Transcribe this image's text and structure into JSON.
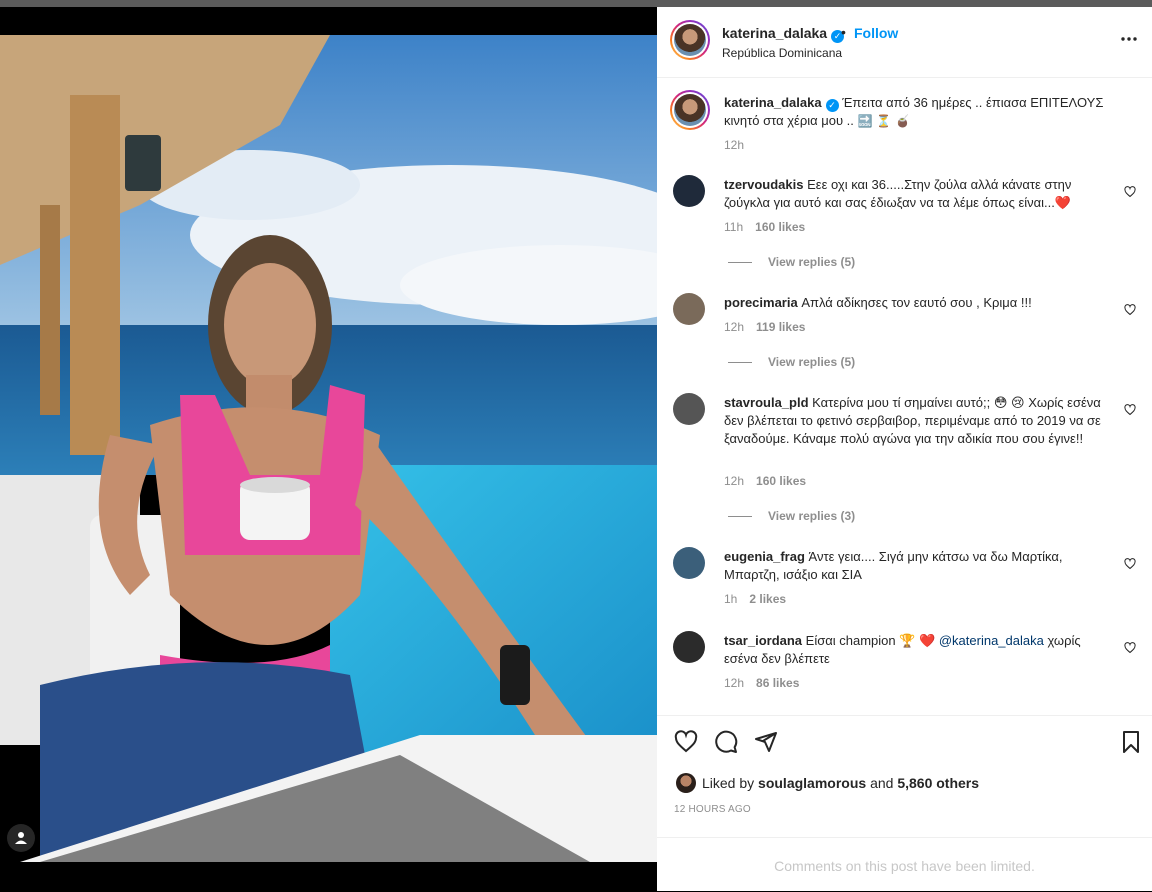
{
  "post": {
    "author": "katerina_dalaka",
    "follow_label": "Follow",
    "location": "República Dominicana",
    "more_label": "•••",
    "caption_text": "Έπειτα από 36 ημέρες .. έπιασα ΕΠΙΤΕΛΟΥΣ κινητό στα χέρια μου ..",
    "caption_emoji": "🔜 ⏳ 🧉",
    "caption_time": "12h"
  },
  "comments": [
    {
      "user": "tzervoudakis",
      "text": "Εεε οχι και 36.....Στην ζούλα αλλά κάνατε στην ζούγκλα για αυτό και σας έδιωξαν να τα λέμε όπως είναι...❤️",
      "time": "11h",
      "likes": "160 likes",
      "replies": "View replies (5)",
      "avatar_color": "#1f2a3a"
    },
    {
      "user": "porecimaria",
      "text": "Απλά αδίκησες τον εαυτό σου , Κριμα !!!",
      "time": "12h",
      "likes": "119 likes",
      "replies": "View replies (5)",
      "avatar_color": "#7a6a5a"
    },
    {
      "user": "stavroula_pld",
      "text": "Κατερίνα μου τί σημαίνει αυτό;; 😳 😢 Χωρίς εσένα δεν βλέπεται το φετινό σερβαιβορ, περιμέναμε από το 2019 να σε ξαναδούμε. Κάναμε πολύ αγώνα για την αδικία που σου έγινε!!",
      "time": "12h",
      "likes": "160 likes",
      "replies": "View replies (3)",
      "avatar_color": "#555555"
    },
    {
      "user": "eugenia_frag",
      "text": "Άντε γεια.... Σιγά μην κάτσω να δω Μαρτίκα, Μπαρτζη, ισάξιο και ΣΙΑ",
      "time": "1h",
      "likes": "2 likes",
      "replies": "",
      "avatar_color": "#3b5f7a"
    },
    {
      "user": "tsar_iordana",
      "text_before": "Είσαι champion 🏆 ❤️ ",
      "mention": "@katerina_dalaka",
      "text_after": " χωρίς εσένα δεν βλέπετε",
      "time": "12h",
      "likes": "86 likes",
      "replies": "",
      "avatar_color": "#2b2b2b"
    }
  ],
  "actions": {
    "liked_by_prefix": "Liked by",
    "liked_by_user": "soulaglamorous",
    "liked_by_and": "and",
    "liked_by_others": "5,860 others",
    "time_ago": "12 HOURS AGO",
    "limited": "Comments on this post have been limited."
  },
  "colors": {
    "accent": "#0095f6",
    "muted": "#8e8e8e",
    "text": "#262626",
    "heart_red": "#ed4956"
  }
}
